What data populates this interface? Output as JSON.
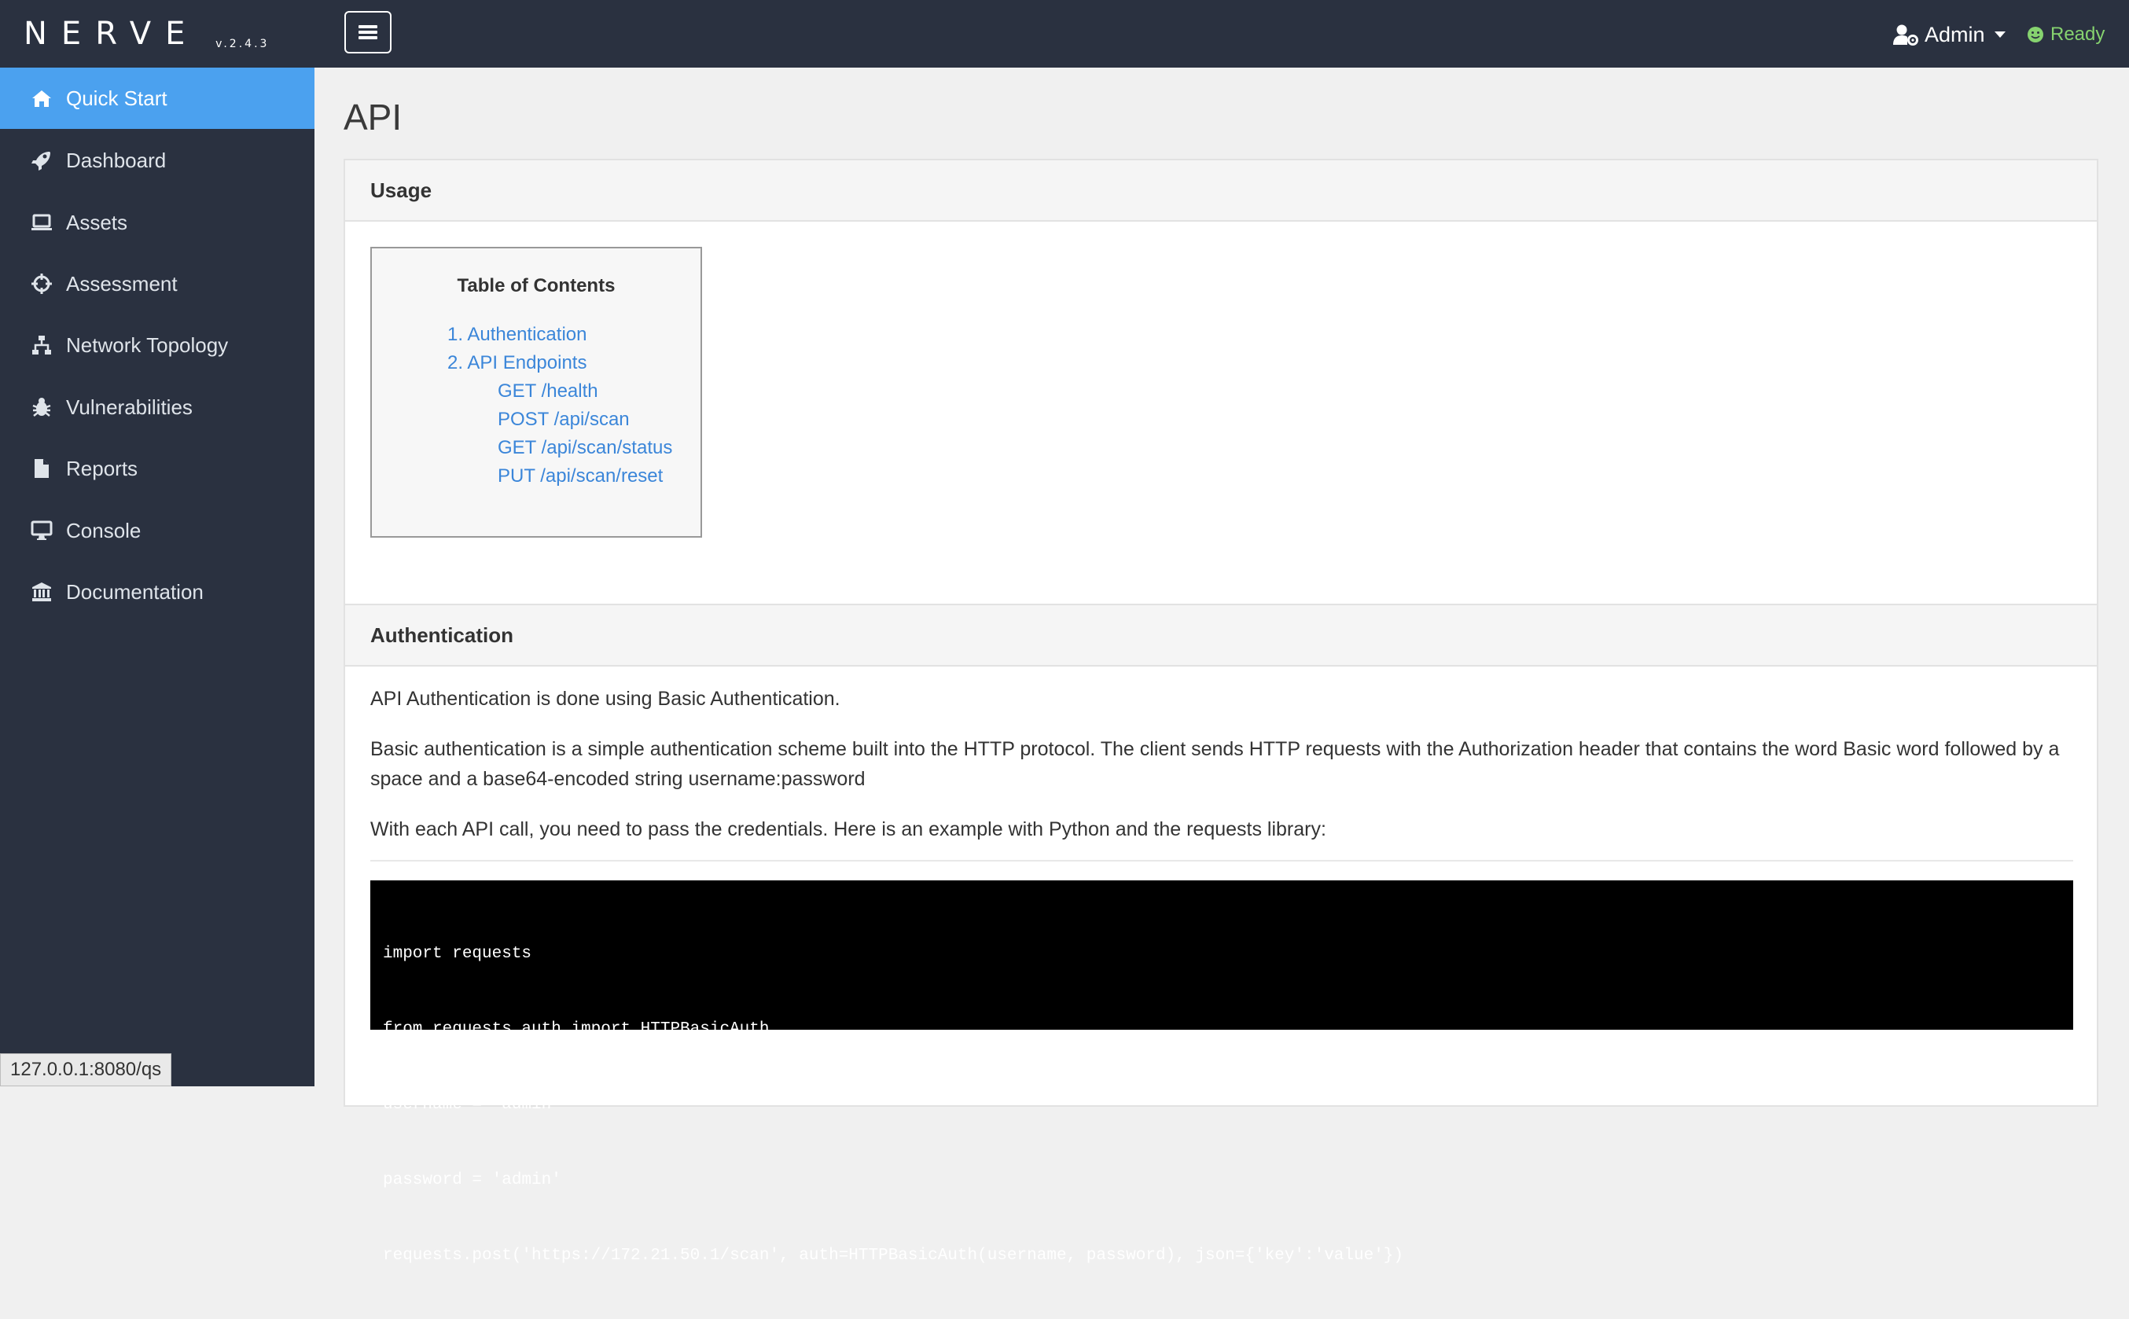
{
  "brand": {
    "name": "NERVE",
    "version": "v.2.4.3"
  },
  "topbar": {
    "user_label": "Admin",
    "status_label": "Ready",
    "status_color": "#86d36f"
  },
  "sidebar": {
    "items": [
      {
        "label": "Quick Start",
        "icon": "home-icon",
        "active": true
      },
      {
        "label": "Dashboard",
        "icon": "rocket-icon"
      },
      {
        "label": "Assets",
        "icon": "laptop-icon"
      },
      {
        "label": "Assessment",
        "icon": "crosshairs-icon"
      },
      {
        "label": "Network Topology",
        "icon": "sitemap-icon"
      },
      {
        "label": "Vulnerabilities",
        "icon": "bug-icon"
      },
      {
        "label": "Reports",
        "icon": "file-icon"
      },
      {
        "label": "Console",
        "icon": "desktop-icon"
      },
      {
        "label": "Documentation",
        "icon": "university-icon"
      }
    ],
    "accent_color": "#4ba1ef"
  },
  "main": {
    "title": "API",
    "usage": {
      "header": "Usage",
      "toc": {
        "title": "Table of Contents",
        "items": [
          "1. Authentication",
          "2. API Endpoints",
          "GET /health",
          "POST /api/scan",
          "GET /api/scan/status",
          "PUT /api/scan/reset"
        ]
      }
    },
    "authentication": {
      "header": "Authentication",
      "paragraphs": [
        "API Authentication is done using Basic Authentication.",
        "Basic authentication is a simple authentication scheme built into the HTTP protocol. The client sends HTTP requests with the Authorization header that contains the word Basic word followed by a space and a base64-encoded string username:password",
        "With each API call, you need to pass the credentials. Here is an example with Python and the requests library:"
      ],
      "code_lines": [
        "import requests",
        "from requests.auth import HTTPBasicAuth",
        "username = 'admin'",
        "password = 'admin'",
        "requests.post('https://172.21.50.1/scan', auth=HTTPBasicAuth(username, password), json={'key':'value'})"
      ]
    }
  },
  "browser_status": {
    "url": "127.0.0.1:8080/qs"
  }
}
